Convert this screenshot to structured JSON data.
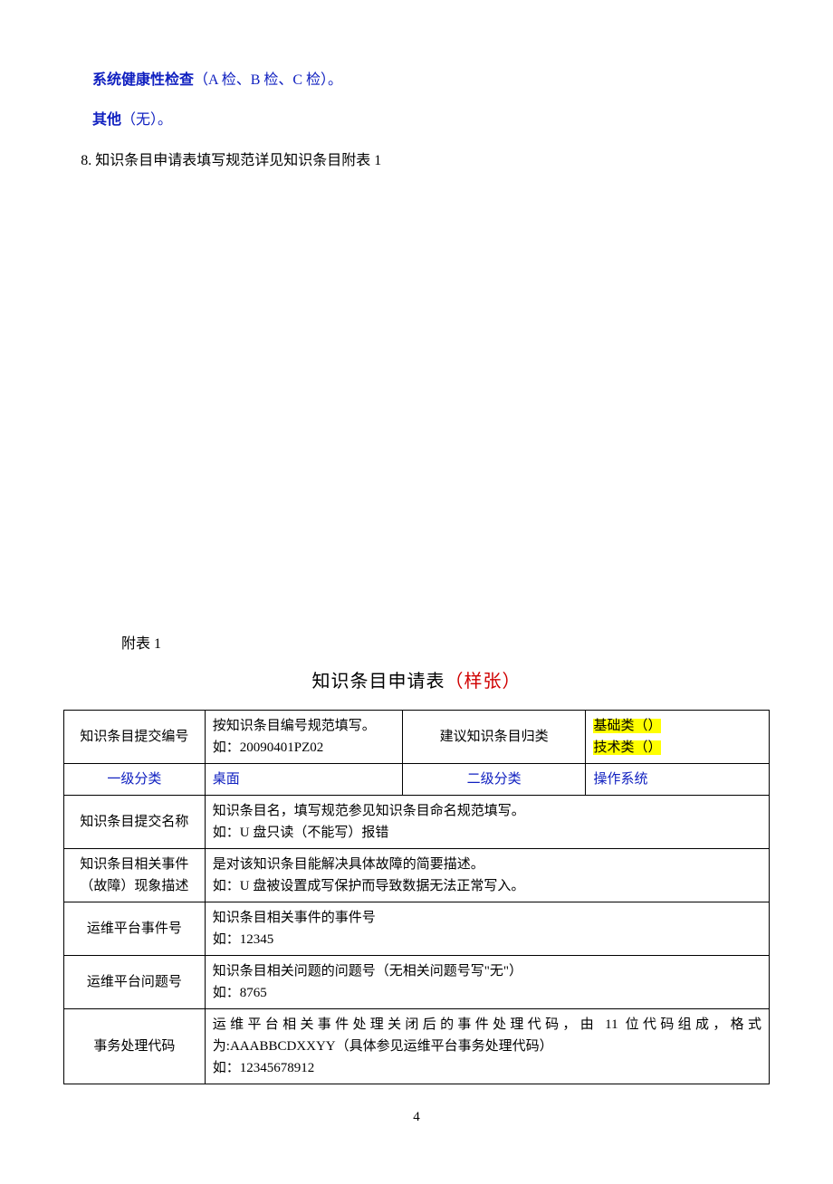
{
  "top": {
    "line1_bold": "系统健康性检查",
    "line1_rest": "（A 检、B 检、C 检）。",
    "line2_bold": "其他",
    "line2_rest": "（无）。"
  },
  "numbered": "8. 知识条目申请表填写规范详见知识条目附表 1",
  "appendix_label": "附表 1",
  "table_title_main": "知识条目申请表",
  "table_title_red": "（样张）",
  "table": {
    "r1_c1": "知识条目提交编号",
    "r1_c2_a": "按知识条目编号规范填写。",
    "r1_c2_b": "如：20090401PZ02",
    "r1_c3": "建议知识条目归类",
    "r1_c4_a": "基础类（）",
    "r1_c4_b": "技术类（）",
    "r2_c1": "一级分类",
    "r2_c2": "桌面",
    "r2_c3": "二级分类",
    "r2_c4": "操作系统",
    "r3_c1": "知识条目提交名称",
    "r3_c2_a": "知识条目名，填写规范参见知识条目命名规范填写。",
    "r3_c2_b": "如：U 盘只读（不能写）报错",
    "r4_c1_a": "知识条目相关事件",
    "r4_c1_b": "（故障）现象描述",
    "r4_c2_a": "是对该知识条目能解决具体故障的简要描述。",
    "r4_c2_b": "如：U 盘被设置成写保护而导致数据无法正常写入。",
    "r5_c1": "运维平台事件号",
    "r5_c2_a": "知识条目相关事件的事件号",
    "r5_c2_b": "如：12345",
    "r6_c1": "运维平台问题号",
    "r6_c2_a": "知识条目相关问题的问题号（无相关问题号写\"无\"）",
    "r6_c2_b": "如：8765",
    "r7_c1": "事务处理代码",
    "r7_c2_a": "运维平台相关事件处理关闭后的事件处理代码，由 11 位代码组成，格式为:AAABBCDXXYY（具体参见运维平台事务处理代码）",
    "r7_c2_b": "如：12345678912"
  },
  "page_num": "4"
}
